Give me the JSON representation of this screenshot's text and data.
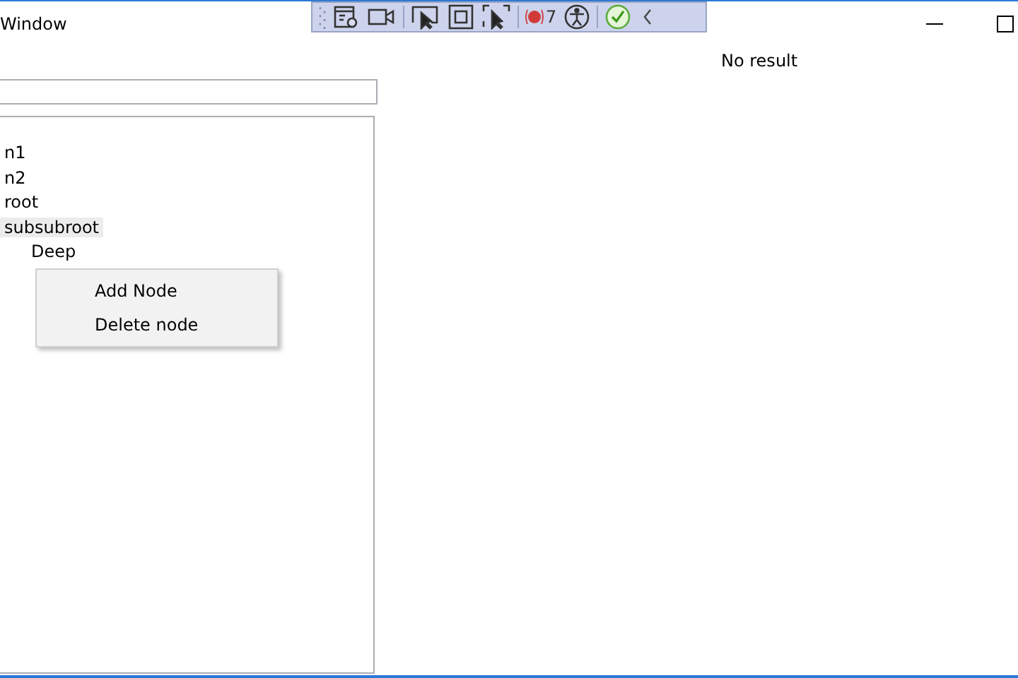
{
  "window": {
    "title": "Window"
  },
  "toolbar": {
    "binding_failures": "7"
  },
  "tree": {
    "items": [
      {
        "label": "n1",
        "selected": false
      },
      {
        "label": "n2",
        "selected": false
      },
      {
        "label": "root",
        "selected": false
      },
      {
        "label": "subsubroot",
        "selected": true,
        "children": [
          {
            "label": "Deep",
            "selected": false
          }
        ]
      }
    ]
  },
  "context_menu": {
    "items": [
      "Add Node",
      "Delete node"
    ]
  },
  "result": "No result"
}
